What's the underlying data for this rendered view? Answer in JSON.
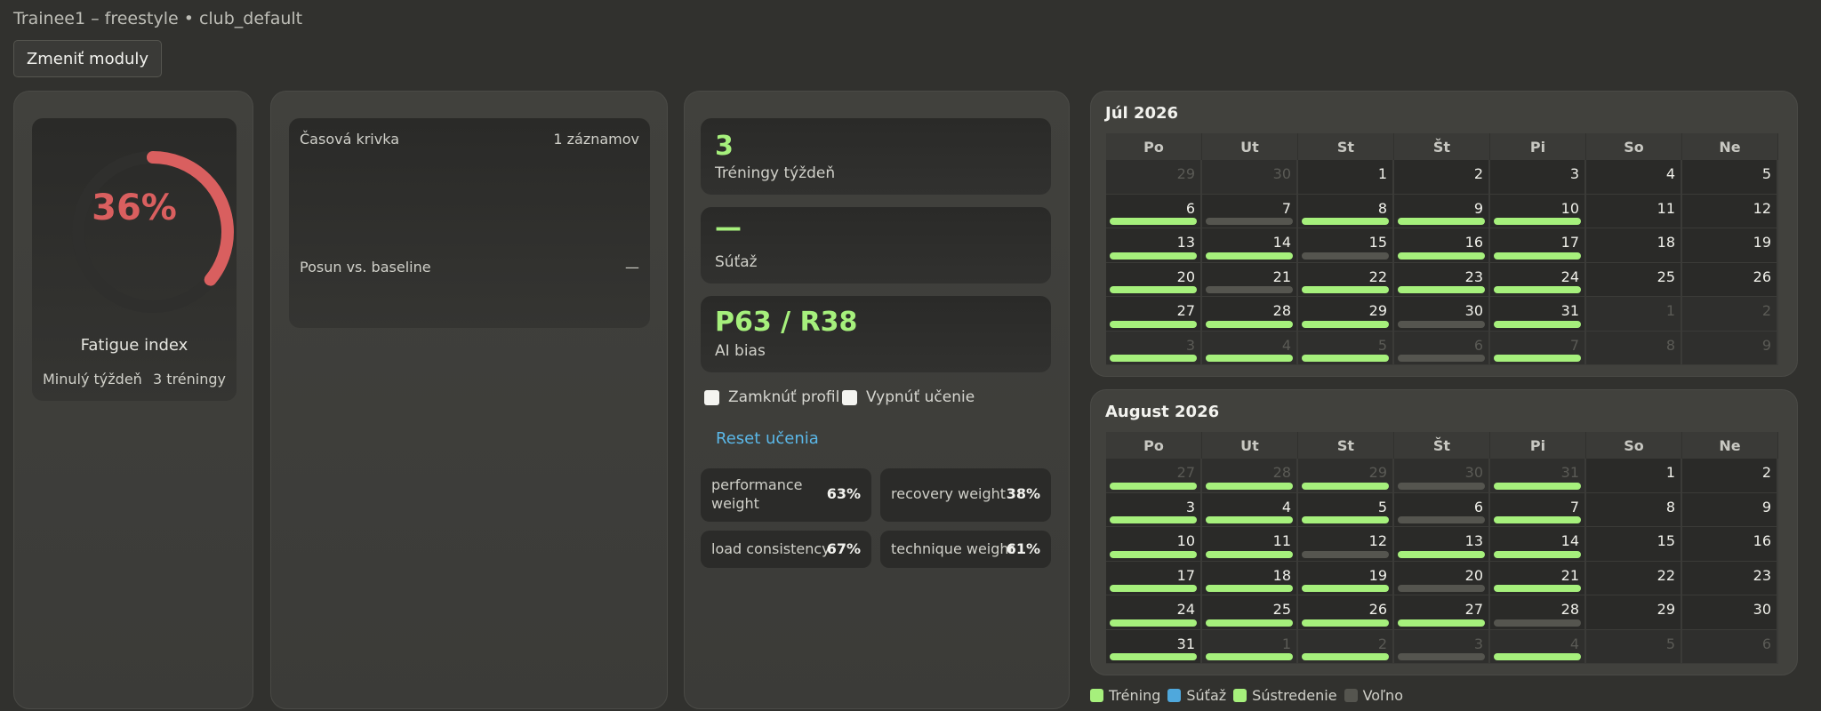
{
  "header": {
    "title": "Trainee1 – freestyle • club_default",
    "change_modules": "Zmeniť moduly"
  },
  "fatigue": {
    "percent": "36%",
    "value": 0.36,
    "label": "Fatigue index",
    "last_week_label": "Minulý týždeň",
    "last_week_value": "3 tréningy",
    "color": "#d95f5f"
  },
  "timeline": {
    "curve_label": "Časová krivka",
    "records": "1 záznamov",
    "shift_label": "Posun vs. baseline",
    "shift_value": "—"
  },
  "stats": {
    "trainings": {
      "value": "3",
      "label": "Tréningy týždeň"
    },
    "competition": {
      "value": "—",
      "label": "Súťaž"
    },
    "ai_bias": {
      "value": "P63 / R38",
      "label": "AI bias"
    }
  },
  "controls": {
    "lock_profile": "Zamknúť profil",
    "disable_learning": "Vypnúť učenie",
    "reset_learning": "Reset učenia"
  },
  "weights": [
    {
      "label": "performance weight",
      "value": "63%"
    },
    {
      "label": "recovery weight",
      "value": "38%"
    },
    {
      "label": "load consistency",
      "value": "67%"
    },
    {
      "label": "technique weight",
      "value": "61%"
    }
  ],
  "weekdays": [
    "Po",
    "Ut",
    "St",
    "Št",
    "Pi",
    "So",
    "Ne"
  ],
  "calendars": [
    {
      "title": "Júl 2026",
      "days": [
        {
          "d": "29",
          "out": true,
          "b": ""
        },
        {
          "d": "30",
          "out": true,
          "b": ""
        },
        {
          "d": "1",
          "b": ""
        },
        {
          "d": "2",
          "b": ""
        },
        {
          "d": "3",
          "b": ""
        },
        {
          "d": "4",
          "b": ""
        },
        {
          "d": "5",
          "b": ""
        },
        {
          "d": "6",
          "b": "train"
        },
        {
          "d": "7",
          "b": "free"
        },
        {
          "d": "8",
          "b": "train"
        },
        {
          "d": "9",
          "b": "train"
        },
        {
          "d": "10",
          "b": "train"
        },
        {
          "d": "11",
          "b": ""
        },
        {
          "d": "12",
          "b": ""
        },
        {
          "d": "13",
          "b": "train"
        },
        {
          "d": "14",
          "b": "train"
        },
        {
          "d": "15",
          "b": "free"
        },
        {
          "d": "16",
          "b": "train"
        },
        {
          "d": "17",
          "b": "train"
        },
        {
          "d": "18",
          "b": ""
        },
        {
          "d": "19",
          "b": ""
        },
        {
          "d": "20",
          "b": "train"
        },
        {
          "d": "21",
          "b": "free"
        },
        {
          "d": "22",
          "b": "train"
        },
        {
          "d": "23",
          "b": "train"
        },
        {
          "d": "24",
          "b": "train"
        },
        {
          "d": "25",
          "b": ""
        },
        {
          "d": "26",
          "b": ""
        },
        {
          "d": "27",
          "b": "train"
        },
        {
          "d": "28",
          "b": "train"
        },
        {
          "d": "29",
          "b": "train"
        },
        {
          "d": "30",
          "b": "free"
        },
        {
          "d": "31",
          "b": "train"
        },
        {
          "d": "1",
          "out": true,
          "b": ""
        },
        {
          "d": "2",
          "out": true,
          "b": ""
        },
        {
          "d": "3",
          "out": true,
          "b": "train"
        },
        {
          "d": "4",
          "out": true,
          "b": "train"
        },
        {
          "d": "5",
          "out": true,
          "b": "train"
        },
        {
          "d": "6",
          "out": true,
          "b": "free"
        },
        {
          "d": "7",
          "out": true,
          "b": "train"
        },
        {
          "d": "8",
          "out": true,
          "b": ""
        },
        {
          "d": "9",
          "out": true,
          "b": ""
        }
      ]
    },
    {
      "title": "August 2026",
      "days": [
        {
          "d": "27",
          "out": true,
          "b": "train"
        },
        {
          "d": "28",
          "out": true,
          "b": "train"
        },
        {
          "d": "29",
          "out": true,
          "b": "train"
        },
        {
          "d": "30",
          "out": true,
          "b": "free"
        },
        {
          "d": "31",
          "out": true,
          "b": "train"
        },
        {
          "d": "1",
          "b": ""
        },
        {
          "d": "2",
          "b": ""
        },
        {
          "d": "3",
          "b": "train"
        },
        {
          "d": "4",
          "b": "train"
        },
        {
          "d": "5",
          "b": "train"
        },
        {
          "d": "6",
          "b": "free"
        },
        {
          "d": "7",
          "b": "train"
        },
        {
          "d": "8",
          "b": ""
        },
        {
          "d": "9",
          "b": ""
        },
        {
          "d": "10",
          "b": "train"
        },
        {
          "d": "11",
          "b": "train"
        },
        {
          "d": "12",
          "b": "free"
        },
        {
          "d": "13",
          "b": "train"
        },
        {
          "d": "14",
          "b": "train"
        },
        {
          "d": "15",
          "b": ""
        },
        {
          "d": "16",
          "b": ""
        },
        {
          "d": "17",
          "b": "train"
        },
        {
          "d": "18",
          "b": "train"
        },
        {
          "d": "19",
          "b": "train"
        },
        {
          "d": "20",
          "b": "free"
        },
        {
          "d": "21",
          "b": "train"
        },
        {
          "d": "22",
          "b": ""
        },
        {
          "d": "23",
          "b": ""
        },
        {
          "d": "24",
          "b": "train"
        },
        {
          "d": "25",
          "b": "train"
        },
        {
          "d": "26",
          "b": "train"
        },
        {
          "d": "27",
          "b": "train"
        },
        {
          "d": "28",
          "b": "free"
        },
        {
          "d": "29",
          "b": ""
        },
        {
          "d": "30",
          "b": ""
        },
        {
          "d": "31",
          "b": "train"
        },
        {
          "d": "1",
          "out": true,
          "b": "train"
        },
        {
          "d": "2",
          "out": true,
          "b": "train"
        },
        {
          "d": "3",
          "out": true,
          "b": "free"
        },
        {
          "d": "4",
          "out": true,
          "b": "train"
        },
        {
          "d": "5",
          "out": true,
          "b": ""
        },
        {
          "d": "6",
          "out": true,
          "b": ""
        }
      ]
    }
  ],
  "legend": [
    {
      "label": "Tréning",
      "color": "#a6f07c"
    },
    {
      "label": "Súťaž",
      "color": "#4fa8dc"
    },
    {
      "label": "Sústredenie",
      "color": "#a6f07c"
    },
    {
      "label": "Voľno",
      "color": "#55554f"
    }
  ]
}
